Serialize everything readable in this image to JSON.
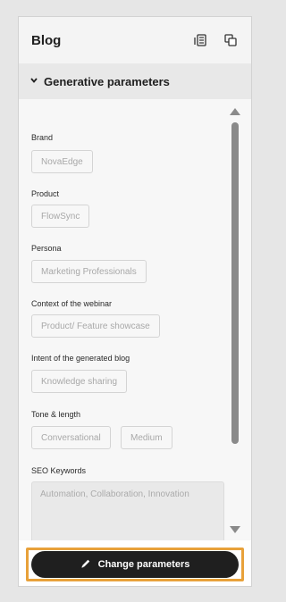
{
  "header": {
    "title": "Blog"
  },
  "section": {
    "label": "Generative parameters",
    "expanded": true
  },
  "fields": {
    "brand": {
      "label": "Brand",
      "value": "NovaEdge"
    },
    "product": {
      "label": "Product",
      "value": "FlowSync"
    },
    "persona": {
      "label": "Persona",
      "value": "Marketing Professionals"
    },
    "context": {
      "label": "Context of the webinar",
      "value": "Product/ Feature showcase"
    },
    "intent": {
      "label": "Intent of the generated blog",
      "value": "Knowledge sharing"
    },
    "tone": {
      "label": "Tone & length",
      "tone_value": "Conversational",
      "length_value": "Medium"
    },
    "seo": {
      "label": "SEO Keywords",
      "value": "Automation, Collaboration, Innovation"
    }
  },
  "footer": {
    "button_label": "Change parameters"
  },
  "colors": {
    "highlight": "#e8a13a",
    "button_bg": "#1f1f1f",
    "scrollbar": "#8a8a8a"
  },
  "icons": [
    "list-view-icon",
    "copy-icon",
    "chevron-down-icon",
    "pencil-icon",
    "scroll-up-arrow-icon",
    "scroll-down-arrow-icon"
  ]
}
